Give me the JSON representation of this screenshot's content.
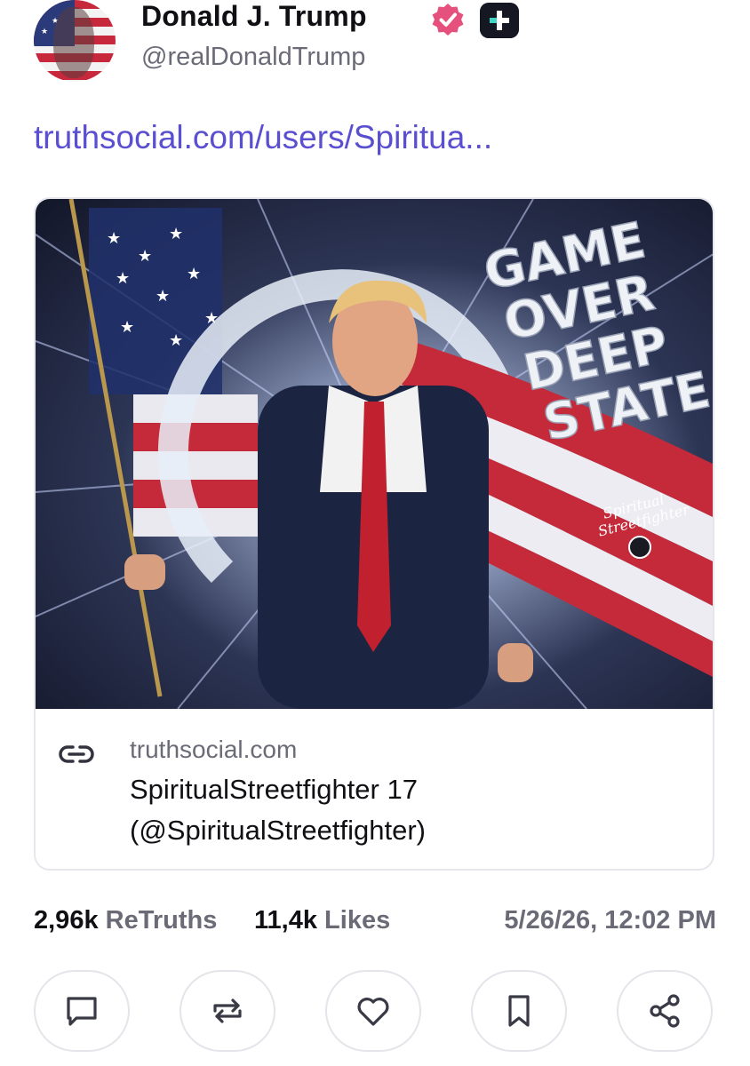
{
  "post": {
    "author_name": "Donald J. Trump",
    "author_handle": "@realDonaldTrump",
    "avatar_icon": "user-avatar",
    "verified_icon": "verified-badge-icon",
    "plus_icon": "plus-badge-icon",
    "link_text": "truthsocial.com/users/Spiritua...",
    "accent_color": "#5b4fd1",
    "verified_color": "#e5507d"
  },
  "card": {
    "image_text": {
      "line1": "GAME",
      "line2": "OVER",
      "line3": "DEEP",
      "line4": "STATE",
      "watermark_line1": "Spiritual",
      "watermark_line2": "Streetfighter"
    },
    "link_icon": "link-icon",
    "domain": "truthsocial.com",
    "title_line1": "SpiritualStreetfighter 17",
    "title_line2": "(@SpiritualStreetfighter)"
  },
  "stats": {
    "retruths_count": "2,96k",
    "retruths_label": "ReTruths",
    "likes_count": "11,4k",
    "likes_label": "Likes",
    "timestamp": "5/26/26, 12:02 PM"
  },
  "actions": [
    {
      "icon": "comment-icon"
    },
    {
      "icon": "retruth-icon"
    },
    {
      "icon": "heart-icon"
    },
    {
      "icon": "bookmark-icon"
    },
    {
      "icon": "share-icon"
    }
  ]
}
